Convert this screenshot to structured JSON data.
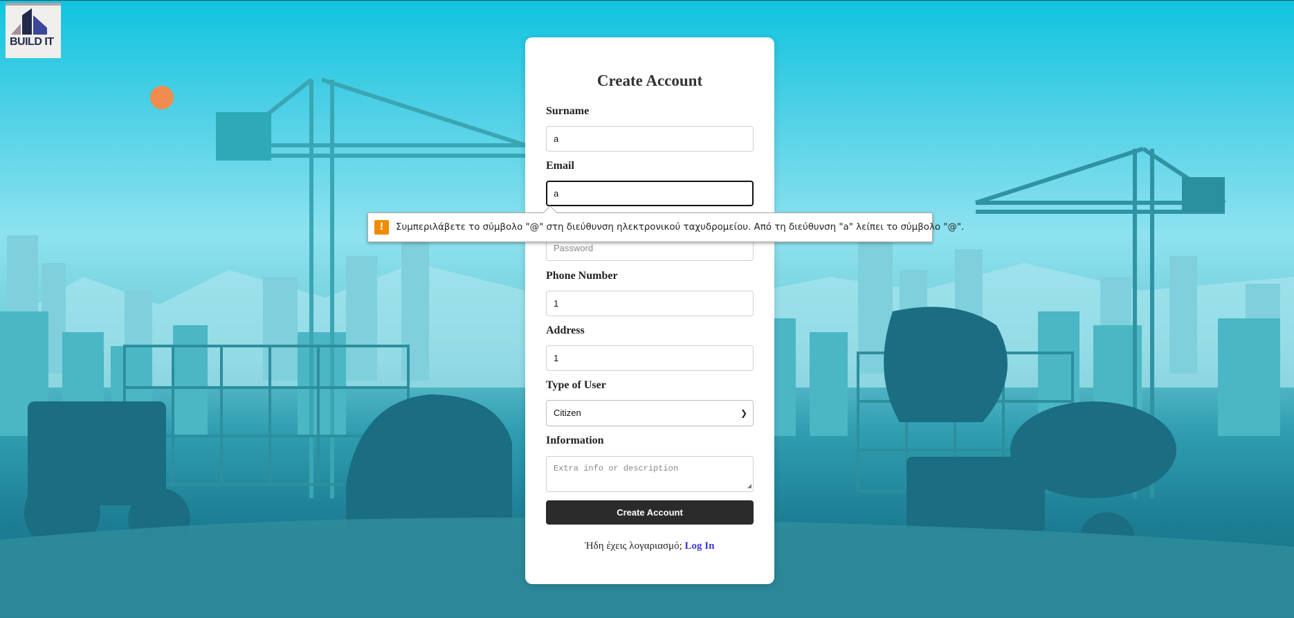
{
  "logo": {
    "text": "BUILD IT"
  },
  "form": {
    "title": "Create Account",
    "fields": {
      "surname": {
        "label": "Surname",
        "value": "a"
      },
      "email": {
        "label": "Email",
        "value": "a"
      },
      "password": {
        "placeholder": "Password"
      },
      "phone": {
        "label": "Phone Number",
        "value": "1"
      },
      "address": {
        "label": "Address",
        "value": "1"
      },
      "user_type": {
        "label": "Type of User",
        "selected": "Citizen"
      },
      "information": {
        "label": "Information",
        "placeholder": "Extra info or description"
      }
    },
    "submit_label": "Create Account",
    "footer_text": "Ήδη έχεις λογαριασμό;",
    "footer_link": "Log In"
  },
  "validation_tooltip": {
    "icon": "warning-icon",
    "message": "Συμπεριλάβετε το σύμβολο \"@\" στη διεύθυνση ηλεκτρονικού ταχυδρομείου. Από τη διεύθυνση \"a\" λείπει το σύμβολο \"@\"."
  },
  "colors": {
    "sky": "#0fc4df",
    "button": "#2b2b2b",
    "link": "#3a3ad8",
    "warning": "#f08a00"
  }
}
